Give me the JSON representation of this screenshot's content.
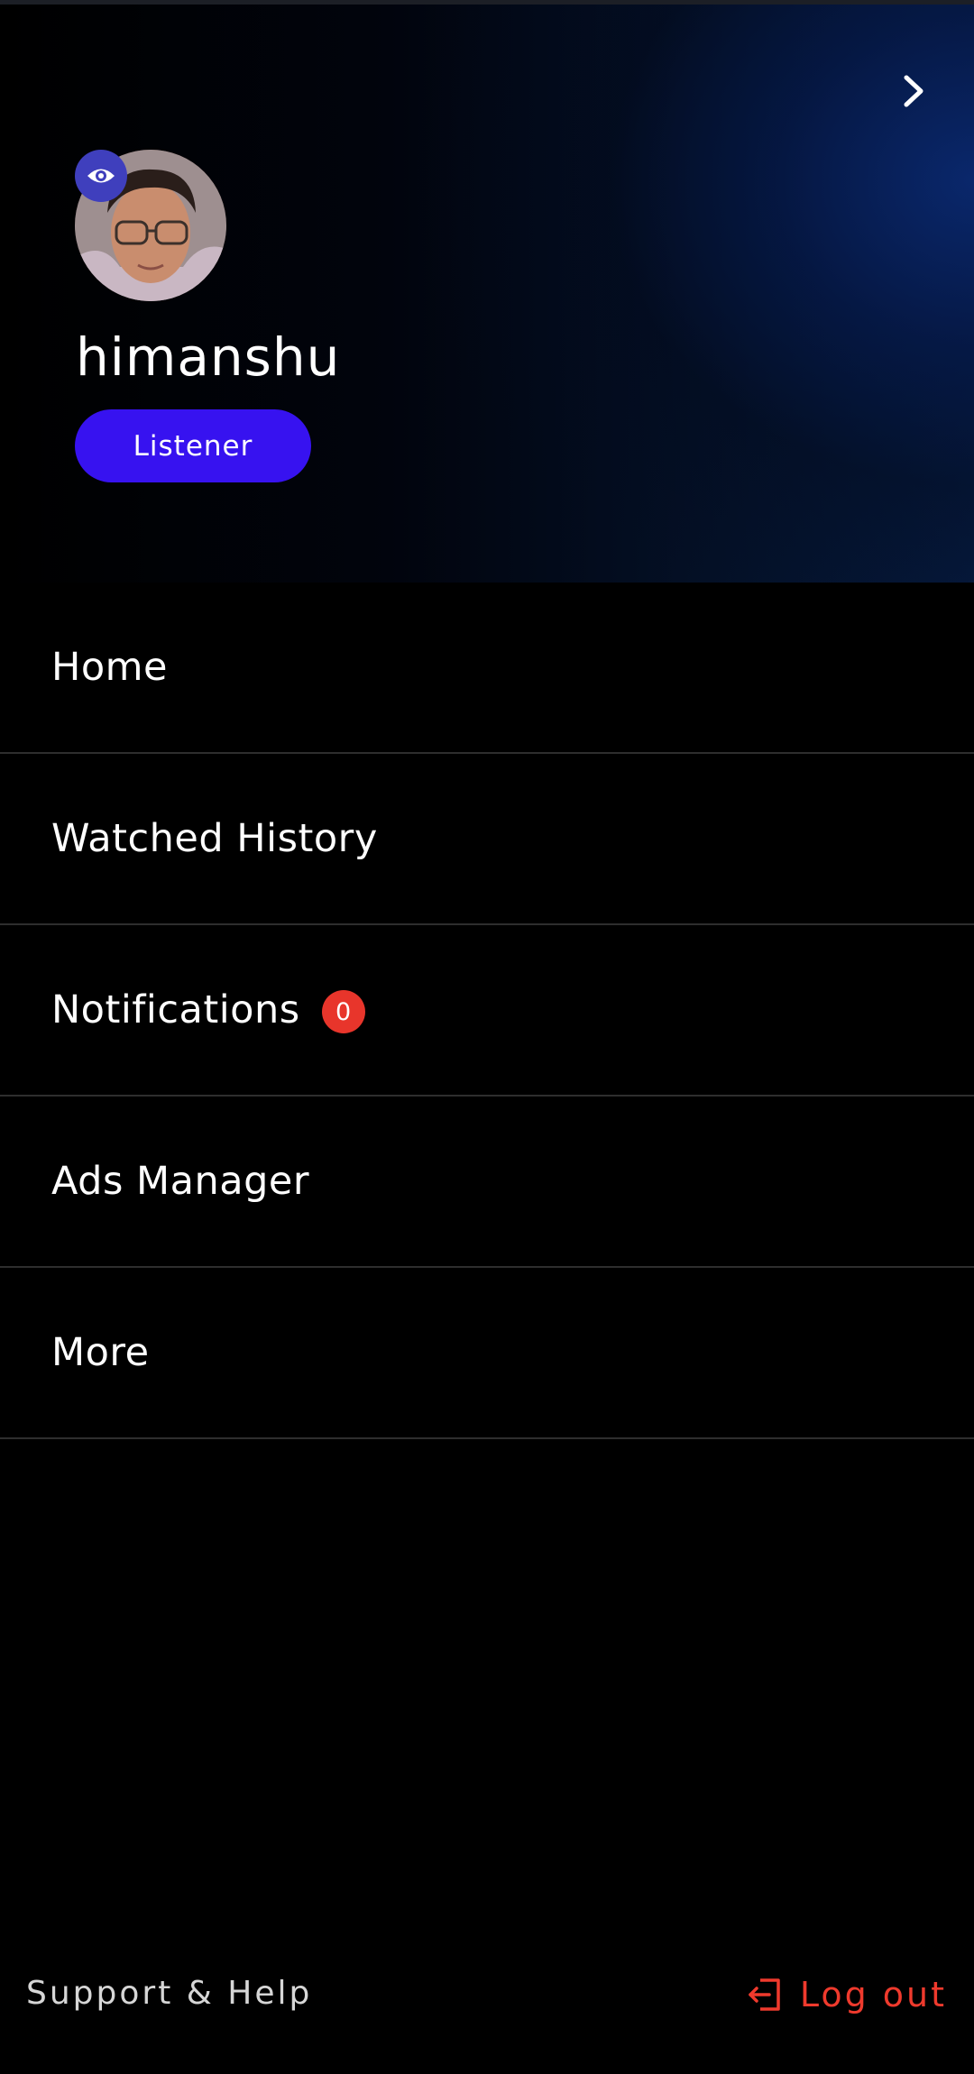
{
  "header": {
    "username": "himanshu",
    "role": "Listener",
    "icons": {
      "close": "chevron-right-icon",
      "avatar_badge": "eye-icon"
    }
  },
  "menu": {
    "items": [
      {
        "label": "Home"
      },
      {
        "label": "Watched History"
      },
      {
        "label": "Notifications",
        "badge": "0"
      },
      {
        "label": "Ads Manager"
      },
      {
        "label": "More"
      }
    ]
  },
  "footer": {
    "support_label": "Support & Help",
    "logout_label": "Log out",
    "logout_icon": "logout-icon"
  },
  "colors": {
    "background": "#000000",
    "role_pill": "#3712f0",
    "badge": "#e8352b",
    "logout": "#ef3a2d",
    "eye_badge": "#3f3fbd"
  }
}
